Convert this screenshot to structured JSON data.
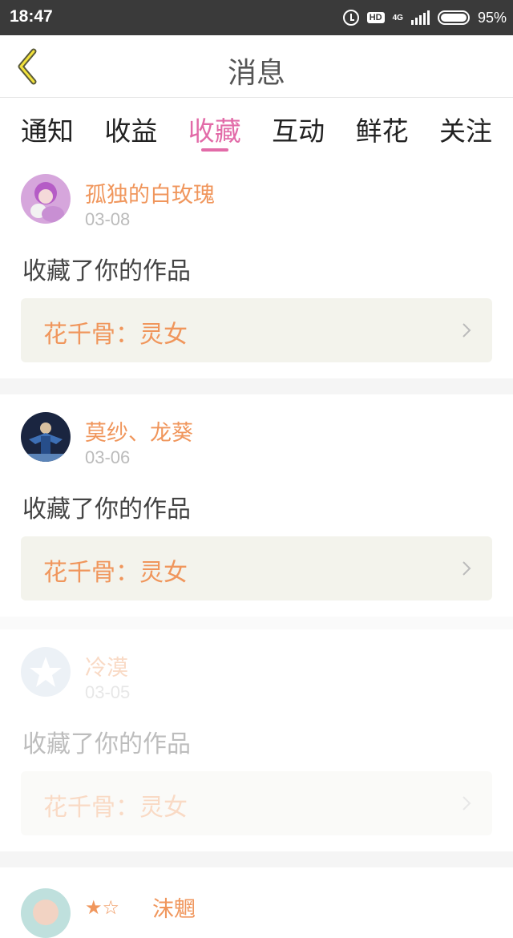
{
  "status": {
    "time": "18:47",
    "hd": "HD",
    "network": "4G",
    "battery": "95%"
  },
  "header": {
    "title": "消息",
    "back_icon": "back-chevron-icon"
  },
  "tabs": [
    {
      "label": "通知",
      "active": false
    },
    {
      "label": "收益",
      "active": false
    },
    {
      "label": "收藏",
      "active": true
    },
    {
      "label": "互动",
      "active": false
    },
    {
      "label": "鲜花",
      "active": false
    },
    {
      "label": "关注",
      "active": false
    }
  ],
  "colors": {
    "accent": "#e26ba8",
    "name": "#f0965c",
    "work_bg": "#f3f3ec"
  },
  "messages": [
    {
      "name": "孤独的白玫瑰",
      "date": "03-08",
      "action": "收藏了你的作品",
      "work": "花千骨：灵女"
    },
    {
      "name": "莫纱、龙葵",
      "date": "03-06",
      "action": "收藏了你的作品",
      "work": "花千骨：灵女"
    },
    {
      "name": "冷漠",
      "date": "03-05",
      "action": "收藏了你的作品",
      "work": "花千骨：灵女"
    },
    {
      "name": "沫魍",
      "stars": "★☆"
    }
  ]
}
